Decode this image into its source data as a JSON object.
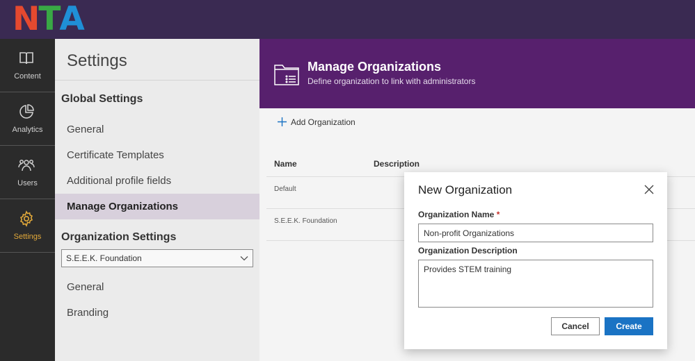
{
  "logo": {
    "letters": [
      "N",
      "T",
      "A"
    ],
    "colors": [
      "#e5492f",
      "#39a845",
      "#1f8fd6"
    ]
  },
  "rail": {
    "items": [
      {
        "label": "Content",
        "icon": "book-icon"
      },
      {
        "label": "Analytics",
        "icon": "pie-chart-icon"
      },
      {
        "label": "Users",
        "icon": "users-icon"
      },
      {
        "label": "Settings",
        "icon": "gear-icon"
      }
    ],
    "active_color": "#e2a93a"
  },
  "settings": {
    "title": "Settings",
    "global_heading": "Global Settings",
    "global_items": [
      "General",
      "Certificate Templates",
      "Additional profile fields",
      "Manage Organizations"
    ],
    "org_heading": "Organization Settings",
    "org_select": "S.E.E.K. Foundation",
    "org_items": [
      "General",
      "Branding"
    ]
  },
  "banner": {
    "title": "Manage Organizations",
    "subtitle": "Define organization to link with administrators",
    "color": "#57206d"
  },
  "toolbar": {
    "add_label": "Add Organization"
  },
  "table": {
    "headers": [
      "Name",
      "Description"
    ],
    "rows": [
      "Default",
      "S.E.E.K. Foundation"
    ]
  },
  "dialog": {
    "title": "New Organization",
    "name_label": "Organization Name",
    "required_mark": "*",
    "name_value": "Non-profit Organizations",
    "desc_label": "Organization Description",
    "desc_value": "Provides STEM training",
    "cancel_label": "Cancel",
    "create_label": "Create",
    "primary_color": "#1a73c4"
  }
}
